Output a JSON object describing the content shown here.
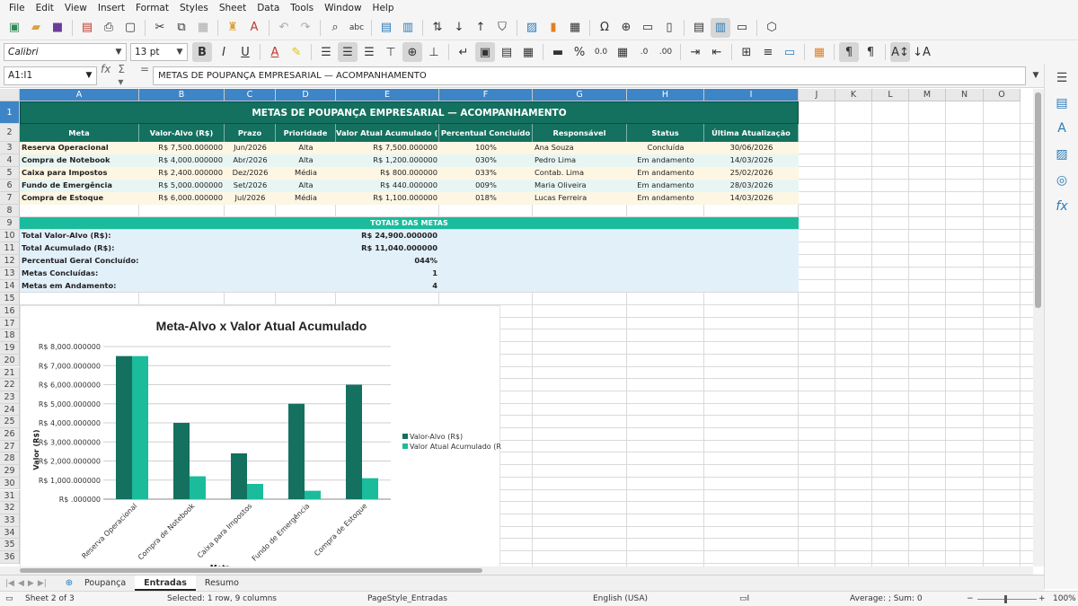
{
  "menu": [
    "File",
    "Edit",
    "View",
    "Insert",
    "Format",
    "Styles",
    "Sheet",
    "Data",
    "Tools",
    "Window",
    "Help"
  ],
  "toolbar": {
    "font_name": "Calibri",
    "font_size": "13 pt",
    "bold": "B",
    "italic": "I",
    "underline": "U",
    "percent": "%",
    "decimal": "0.0"
  },
  "formula_bar": {
    "name_box": "A1:I1",
    "content": "METAS DE POUPANÇA EMPRESARIAL — ACOMPANHAMENTO"
  },
  "columns": [
    "A",
    "B",
    "C",
    "D",
    "E",
    "F",
    "G",
    "H",
    "I",
    "J",
    "K",
    "L",
    "M",
    "N",
    "O"
  ],
  "rows": [
    "1",
    "2",
    "3",
    "4",
    "5",
    "6",
    "7",
    "8",
    "9",
    "10",
    "11",
    "12",
    "13",
    "14",
    "15",
    "16",
    "17",
    "18",
    "19",
    "20",
    "21",
    "22",
    "23",
    "24",
    "25",
    "26",
    "27",
    "28",
    "29",
    "30",
    "31",
    "32",
    "33",
    "34",
    "35",
    "36"
  ],
  "sheet": {
    "title": "METAS DE POUPANÇA EMPRESARIAL — ACOMPANHAMENTO",
    "headers": [
      "Meta",
      "Valor-Alvo (R$)",
      "Prazo",
      "Prioridade",
      "Valor Atual Acumulado (R$)",
      "Percentual Concluído",
      "Responsável",
      "Status",
      "Última Atualização"
    ],
    "data": [
      [
        "Reserva Operacional",
        "R$ 7,500.000000",
        "Jun/2026",
        "Alta",
        "R$ 7,500.000000",
        "100%",
        "Ana Souza",
        "Concluída",
        "30/06/2026"
      ],
      [
        "Compra de Notebook",
        "R$ 4,000.000000",
        "Abr/2026",
        "Alta",
        "R$ 1,200.000000",
        "030%",
        "Pedro Lima",
        "Em andamento",
        "14/03/2026"
      ],
      [
        "Caixa para Impostos",
        "R$ 2,400.000000",
        "Dez/2026",
        "Média",
        "R$ 800.000000",
        "033%",
        "Contab. Lima",
        "Em andamento",
        "25/02/2026"
      ],
      [
        "Fundo de Emergência",
        "R$ 5,000.000000",
        "Set/2026",
        "Alta",
        "R$ 440.000000",
        "009%",
        "Maria Oliveira",
        "Em andamento",
        "28/03/2026"
      ],
      [
        "Compra de Estoque",
        "R$ 6,000.000000",
        "Jul/2026",
        "Média",
        "R$ 1,100.000000",
        "018%",
        "Lucas Ferreira",
        "Em andamento",
        "14/03/2026"
      ]
    ],
    "totals_title": "TOTAIS DAS METAS",
    "totals": [
      [
        "Total Valor-Alvo (R$):",
        "R$ 24,900.000000"
      ],
      [
        "Total Acumulado (R$):",
        "R$ 11,040.000000"
      ],
      [
        "Percentual Geral Concluído:",
        "044%"
      ],
      [
        "Metas Concluídas:",
        "1"
      ],
      [
        "Metas em Andamento:",
        "4"
      ]
    ]
  },
  "chart_data": {
    "type": "bar",
    "title": "Meta-Alvo x Valor Atual Acumulado",
    "xlabel": "Meta",
    "ylabel": "Valor (R$)",
    "categories": [
      "Reserva Operacional",
      "Compra de Notebook",
      "Caixa para Impostos",
      "Fundo de Emergência",
      "Compra de Estoque"
    ],
    "series": [
      {
        "name": "Valor-Alvo (R$)",
        "values": [
          7500,
          4000,
          2400,
          5000,
          6000
        ],
        "color": "#14705f"
      },
      {
        "name": "Valor Atual Acumulado (R$)",
        "values": [
          7500,
          1200,
          800,
          440,
          1100
        ],
        "color": "#1abc9c"
      }
    ],
    "ylim": [
      0,
      8000
    ],
    "yticks": [
      "R$ 8,000.000000",
      "R$ 7,000.000000",
      "R$ 6,000.000000",
      "R$ 5,000.000000",
      "R$ 4,000.000000",
      "R$ 3,000.000000",
      "R$ 2,000.000000",
      "R$ 1,000.000000",
      "R$ .000000"
    ],
    "legend_position": "right",
    "grid": true
  },
  "tabs": [
    "Poupança",
    "Entradas",
    "Resumo"
  ],
  "active_tab": "Entradas",
  "status": {
    "sheet": "Sheet 2 of 3",
    "selection": "Selected: 1 row, 9 columns",
    "page_style": "PageStyle_Entradas",
    "language": "English (USA)",
    "summary": "Average: ; Sum: 0",
    "zoom": "100%"
  }
}
